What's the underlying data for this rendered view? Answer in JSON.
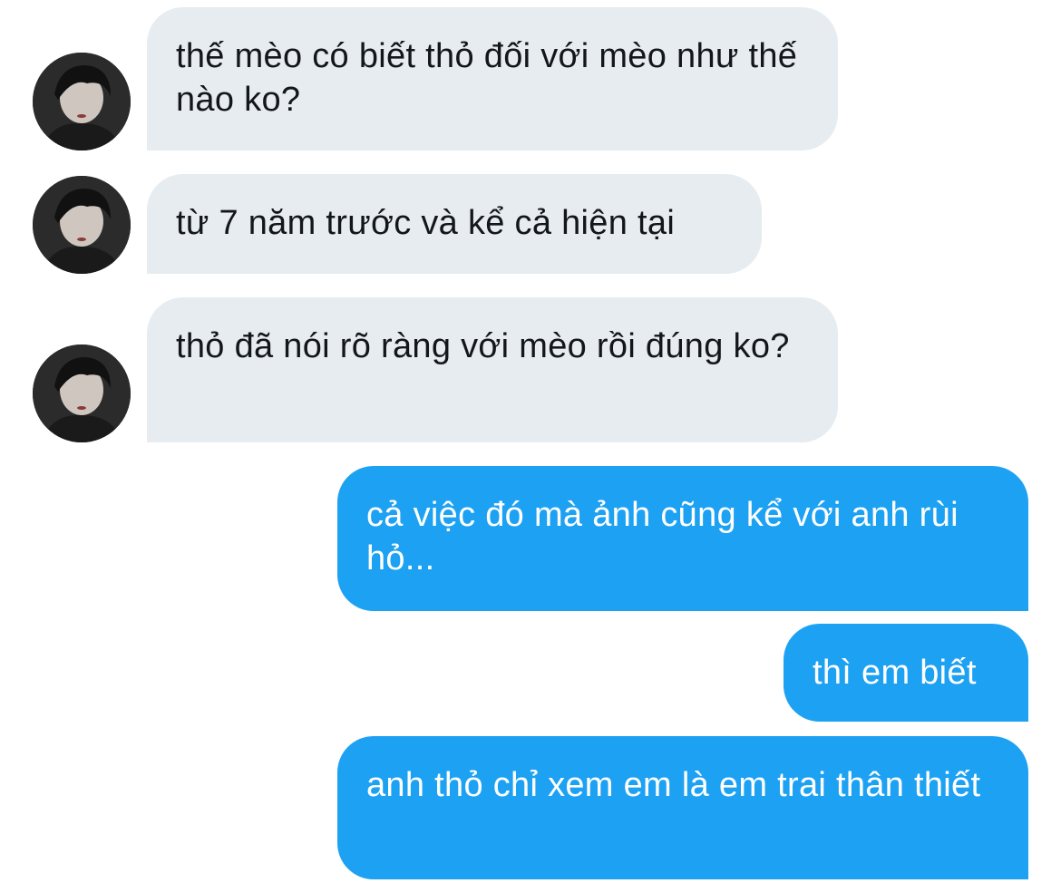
{
  "conversation": {
    "avatar_icon": "profile-photo-avatar",
    "colors": {
      "incoming_bubble": "#e6ecf0",
      "incoming_text": "#14171a",
      "outgoing_bubble": "#1da1f2",
      "outgoing_text": "#ffffff"
    },
    "messages": [
      {
        "direction": "incoming",
        "text": "thế mèo có biết thỏ đối với mèo như thế nào ko?"
      },
      {
        "direction": "incoming",
        "text": "từ 7 năm trước và kể cả hiện tại"
      },
      {
        "direction": "incoming",
        "text": "thỏ đã nói rõ ràng với mèo rồi đúng ko?"
      },
      {
        "direction": "outgoing",
        "text": "cả việc đó mà ảnh cũng kể với anh rùi hỏ..."
      },
      {
        "direction": "outgoing",
        "text": "thì em biết"
      },
      {
        "direction": "outgoing",
        "text": "anh thỏ chỉ xem em là em trai thân thiết"
      }
    ]
  }
}
